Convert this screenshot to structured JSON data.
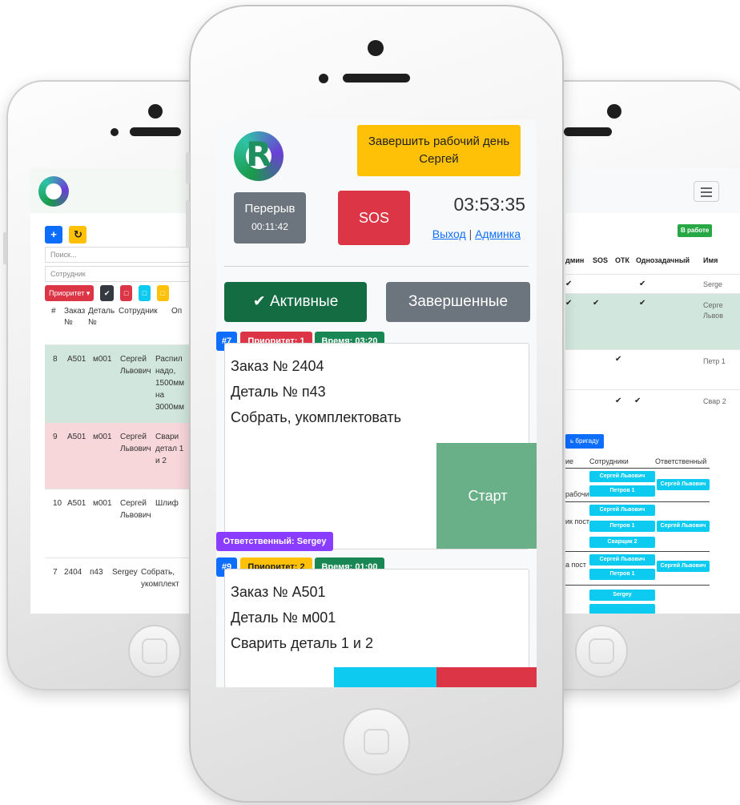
{
  "left_screen": {
    "search_placeholder": "Поиск...",
    "employee_label": "Сотрудник",
    "priority_button": "Приоритет",
    "columns": [
      "#",
      "Заказ №",
      "Деталь №",
      "Сотрудник",
      "Оп"
    ],
    "rows": [
      {
        "num": "8",
        "order": "А501",
        "part": "м001",
        "employee": "Сергей Львович",
        "operation": "Распил надо, 1500мм на 3000мм",
        "status": "success"
      },
      {
        "num": "9",
        "order": "А501",
        "part": "м001",
        "employee": "Сергей Львович",
        "operation": "Свари детал 1 и 2",
        "status": "danger"
      },
      {
        "num": "10",
        "order": "А501",
        "part": "м001",
        "employee": "Сергей Львович",
        "operation": "Шлиф",
        "status": "none"
      },
      {
        "num": "7",
        "order": "2404",
        "part": "п43",
        "employee": "Sergey",
        "operation": "Собрать, укомплект",
        "status": "none"
      }
    ]
  },
  "center_screen": {
    "finish_day_label": "Завершить рабочий день",
    "user_name": "Сергей",
    "break_label": "Перерыв",
    "break_time": "00:11:42",
    "sos_label": "SOS",
    "clock": "03:53:35",
    "logout_link": "Выход",
    "separator": "|",
    "admin_link": "Админка",
    "tab_active": "Активные",
    "tab_done": "Завершенные",
    "tasks": [
      {
        "id": "#7",
        "priority": "Приоритет: 1",
        "time": "Время: 03:20",
        "order": "Заказ № 2404",
        "part": "Деталь № п43",
        "operation": "Собрать, укомплектовать",
        "start_label": "Старт",
        "responsible": "Ответственный: Sergey"
      },
      {
        "id": "#9",
        "priority": "Приоритет: 2",
        "time": "Время: 01:00",
        "order": "Заказ № А501",
        "part": "Деталь № м001",
        "operation": "Сварить деталь 1 и 2"
      }
    ],
    "colors": {
      "primary": "#0d6efd",
      "success_dark": "#146c43",
      "danger": "#dc3545",
      "warning": "#ffc107",
      "secondary": "#6c757d",
      "purple": "#8b3dff",
      "info": "#0dcaf0"
    }
  },
  "right_screen": {
    "status_badge": "В работе",
    "columns": [
      "дмин",
      "SOS",
      "ОТК",
      "Однозадачный",
      "Имя"
    ],
    "names": [
      "Serge",
      "Серге Львов",
      "Петр 1",
      "Свар 2"
    ],
    "team_button": "ь бригаду",
    "team_columns": [
      "ие",
      "Сотрудники",
      "Ответственный"
    ],
    "teams": [
      {
        "label": "рабочие",
        "members": [
          "Сергей Львович",
          "Петров 1"
        ],
        "responsible": "Сергей Львович"
      },
      {
        "label": "ик пост",
        "members": [
          "Сергей Львович",
          "Петров 1",
          "Сварщик 2"
        ],
        "responsible": "Сергей Львович"
      },
      {
        "label": "а пост",
        "members": [
          "Сергей Львович",
          "Петров 1"
        ],
        "responsible": "Сергей Львович"
      },
      {
        "label": "",
        "members": [
          "Sergey"
        ],
        "responsible": ""
      }
    ]
  }
}
